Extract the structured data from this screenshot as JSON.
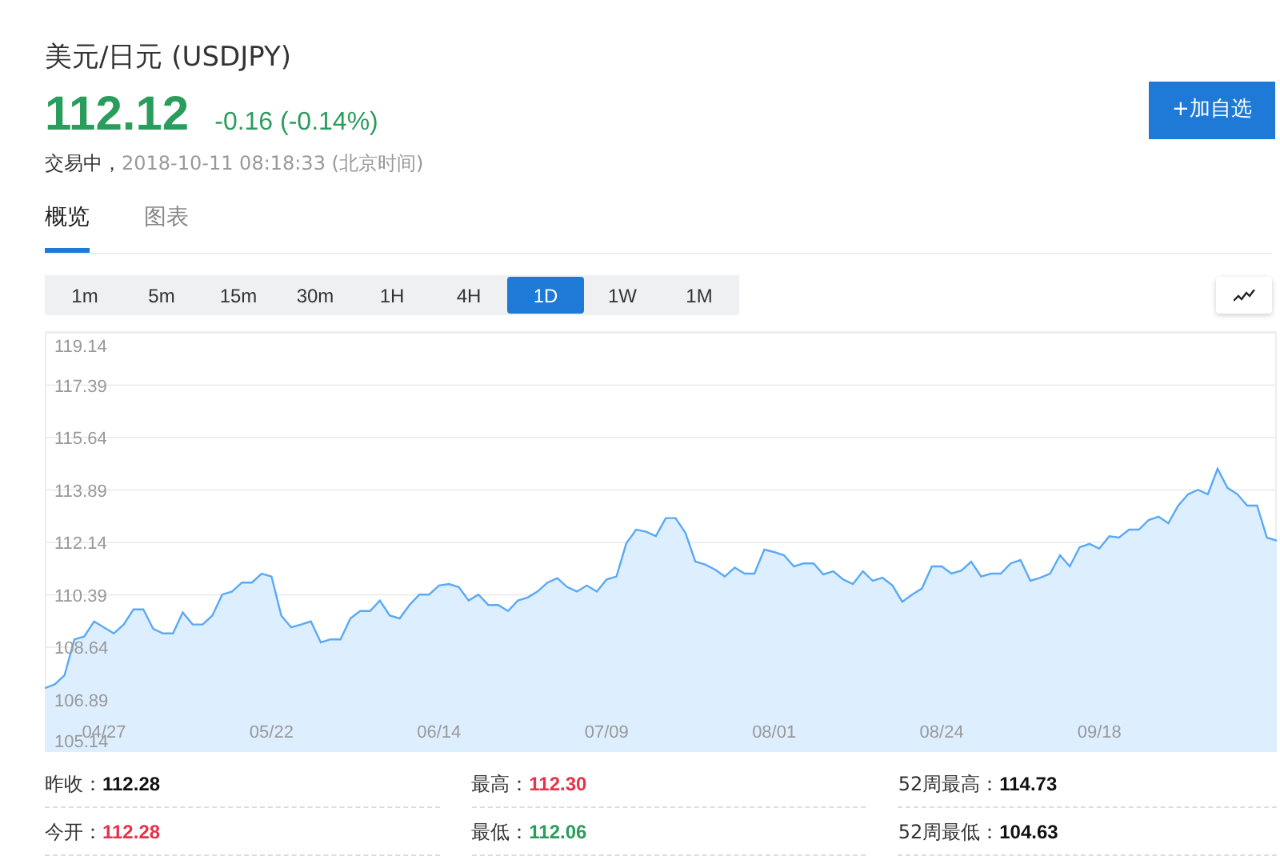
{
  "header": {
    "title": "美元/日元 (USDJPY)",
    "price": "112.12",
    "change": "-0.16 (-0.14%)",
    "status": "交易中，",
    "timestamp": "2018-10-11 08:18:33 (北京时间)",
    "watch_button": "+加自选"
  },
  "tabs": [
    {
      "label": "概览",
      "selected": true
    },
    {
      "label": "图表",
      "selected": false
    }
  ],
  "intervals": [
    {
      "label": "1m",
      "selected": false
    },
    {
      "label": "5m",
      "selected": false
    },
    {
      "label": "15m",
      "selected": false
    },
    {
      "label": "30m",
      "selected": false
    },
    {
      "label": "1H",
      "selected": false
    },
    {
      "label": "4H",
      "selected": false
    },
    {
      "label": "1D",
      "selected": true
    },
    {
      "label": "1W",
      "selected": false
    },
    {
      "label": "1M",
      "selected": false
    }
  ],
  "chart": {
    "chart_data": {
      "type": "area",
      "grid": true,
      "ylim": [
        105.14,
        119.14
      ],
      "categories": [
        null,
        null,
        null,
        null,
        null,
        null,
        "04/27",
        null,
        null,
        null,
        null,
        null,
        null,
        null,
        null,
        null,
        null,
        null,
        null,
        null,
        null,
        null,
        null,
        "05/22",
        null,
        null,
        null,
        null,
        null,
        null,
        null,
        null,
        null,
        null,
        null,
        null,
        null,
        null,
        null,
        null,
        "06/14",
        null,
        null,
        null,
        null,
        null,
        null,
        null,
        null,
        null,
        null,
        null,
        null,
        null,
        null,
        null,
        null,
        "07/09",
        null,
        null,
        null,
        null,
        null,
        null,
        null,
        null,
        null,
        null,
        null,
        null,
        null,
        null,
        null,
        null,
        "08/01",
        null,
        null,
        null,
        null,
        null,
        null,
        null,
        null,
        null,
        null,
        null,
        null,
        null,
        null,
        null,
        null,
        "08/24",
        null,
        null,
        null,
        null,
        null,
        null,
        null,
        null,
        null,
        null,
        null,
        null,
        null,
        null,
        null,
        "09/18",
        null,
        null,
        null,
        null,
        null,
        null,
        null,
        null,
        null,
        null,
        null,
        null,
        null,
        null,
        null,
        null,
        null,
        null
      ],
      "yticks": [
        105.14,
        106.89,
        108.64,
        110.39,
        112.14,
        113.89,
        115.64,
        117.39,
        119.14
      ],
      "series": [
        {
          "color": "#5aa9f5",
          "values": [
            107.27,
            107.4,
            107.7,
            108.9,
            109.0,
            109.5,
            109.3,
            109.1,
            109.4,
            109.9,
            109.9,
            109.25,
            109.1,
            109.1,
            109.8,
            109.4,
            109.4,
            109.7,
            110.4,
            110.5,
            110.8,
            110.8,
            111.1,
            111.0,
            109.7,
            109.3,
            109.4,
            109.5,
            108.8,
            108.9,
            108.9,
            109.6,
            109.85,
            109.85,
            110.2,
            109.7,
            109.6,
            110.05,
            110.4,
            110.4,
            110.7,
            110.75,
            110.65,
            110.2,
            110.4,
            110.05,
            110.05,
            109.85,
            110.2,
            110.3,
            110.5,
            110.8,
            110.95,
            110.65,
            110.5,
            110.7,
            110.5,
            110.9,
            111.0,
            112.1,
            112.57,
            112.5,
            112.35,
            112.95,
            112.95,
            112.46,
            111.5,
            111.4,
            111.23,
            111.0,
            111.3,
            111.1,
            111.1,
            111.9,
            111.82,
            111.71,
            111.34,
            111.44,
            111.44,
            111.07,
            111.18,
            110.9,
            110.75,
            111.18,
            110.86,
            110.96,
            110.7,
            110.16,
            110.4,
            110.6,
            111.34,
            111.34,
            111.1,
            111.2,
            111.5,
            111.0,
            111.1,
            111.1,
            111.44,
            111.55,
            110.86,
            110.96,
            111.1,
            111.71,
            111.34,
            111.98,
            112.09,
            111.93,
            112.35,
            112.3,
            112.57,
            112.57,
            112.89,
            113.0,
            112.78,
            113.37,
            113.75,
            113.9,
            113.75,
            114.6,
            113.96,
            113.75,
            113.37,
            113.37,
            112.3,
            112.2
          ]
        }
      ]
    }
  },
  "stats": [
    {
      "label": "昨收：",
      "value": "112.28",
      "color": "#111111"
    },
    {
      "label": "最高：",
      "value": "112.30",
      "color": "#e5334b"
    },
    {
      "label": "52周最高：",
      "value": "114.73",
      "color": "#111111"
    },
    {
      "label": "今开：",
      "value": "112.28",
      "color": "#e5334b"
    },
    {
      "label": "最低：",
      "value": "112.06",
      "color": "#2a9d5c"
    },
    {
      "label": "52周最低：",
      "value": "104.63",
      "color": "#111111"
    }
  ]
}
